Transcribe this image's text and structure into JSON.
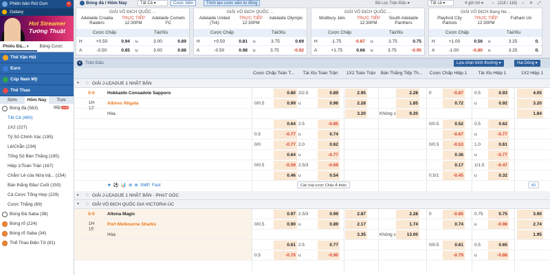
{
  "sidebar": {
    "top_links": [
      "Phiên bản Rút Gọn",
      "Galaxy"
    ],
    "banner": {
      "line1": "Hot Streamer",
      "line2": "Tướng Thuật"
    },
    "tabs": [
      "Phiếu Đặ...",
      "Bảng Cược"
    ],
    "categories": [
      {
        "label": "Thể Vận Hội",
        "color": "#f5a623"
      },
      {
        "label": "Euro",
        "color": "#3b7dd8"
      },
      {
        "label": "Cúp Nam Mỹ",
        "color": "#2ea44f"
      },
      {
        "label": "Thể Thao",
        "color": "#e54b4b"
      }
    ],
    "time_tabs": [
      "Sớm",
      "Hôm Nay",
      "Trực tiếp"
    ],
    "live_badge": "LIVE",
    "sports_top": {
      "label": "Bóng đá",
      "count": "(563)"
    },
    "items": [
      {
        "label": "Tất Cả",
        "count": "(480)"
      },
      {
        "label": "1X2",
        "count": "(227)"
      },
      {
        "label": "Tỷ Số Chính Xác",
        "count": "(195)"
      },
      {
        "label": "Lẻ/Chẵn",
        "count": "(234)"
      },
      {
        "label": "Tổng Số Bàn Thắng",
        "count": "(195)"
      },
      {
        "label": "Hiệp 1/Toàn Trận",
        "count": "(167)"
      },
      {
        "label": "Chẵn/ Lẻ của Nửa trậ...",
        "count": "(154)"
      },
      {
        "label": "Bàn thắng Đầu/ Cuối",
        "count": "(150)"
      },
      {
        "label": "Cá Cược Tổng Hợp",
        "count": "(229)"
      },
      {
        "label": "Cược Thắng",
        "count": "(69)"
      }
    ],
    "sports_bottom": [
      {
        "label": "Bóng Đá Saba",
        "count": "(38)"
      },
      {
        "label": "Bóng rổ",
        "count": "(224)"
      },
      {
        "label": "Bóng rổ Saba",
        "count": "(34)"
      },
      {
        "label": "Thể Thao Điện Tử",
        "count": "(81)"
      }
    ]
  },
  "topbar": {
    "title": "Bóng đá / Hôm Nay",
    "select_all": "Tất Cả",
    "btn_bet": "Cược Xiên",
    "btn_create": "Trình tạo cược xiên tự động",
    "filter": "Bộ Lọc Trận Đấu",
    "filter_all": "Tất cả",
    "hours": "4 giờ tới",
    "pager": "(118 / 118)",
    "cards": [
      {
        "league": "GIẢI VÔ ĐỊCH QUỐC ...",
        "home": "Adelaide Croatia Raiders",
        "away": "Adelaide Comets FC",
        "live": "TRỰC TIẾP",
        "time": "12:30PM",
        "hdr": [
          "Cược Chấp",
          "Tài/Xỉu"
        ],
        "rows": [
          {
            "a": "H",
            "b": "+0.50",
            "c": "0.94",
            "d": "u",
            "e": "3.00",
            "f": "0.89",
            "cneg": false,
            "fneg": false
          },
          {
            "a": "A",
            "b": "-0.50",
            "c": "0.85",
            "d": "u",
            "e": "3.00",
            "f": "0.88",
            "cneg": false,
            "fneg": false
          }
        ]
      },
      {
        "league": "GIẢI VÔ ĐỊCH QUỐC ...",
        "home": "Adelaide United (Trẻ)",
        "away": "Adelaide Olympic",
        "live": "TRỰC TIẾP",
        "time": "12:30PM",
        "hdr": [
          "Cược Chấp",
          "Tài/Xỉu"
        ],
        "rows": [
          {
            "a": "H",
            "b": "+0.50",
            "c": "0.81",
            "d": "u",
            "e": "3.75",
            "f": "0.69",
            "cneg": false,
            "fneg": false
          },
          {
            "a": "A",
            "b": "-0.50",
            "c": "0.98",
            "d": "u",
            "e": "3.75",
            "f": "-0.92",
            "cneg": false,
            "fneg": true
          }
        ]
      },
      {
        "league": "GIẢI VÔ ĐỊCH QUỐC ...",
        "home": "Modbury Jets",
        "away": "South Adelaide Panthers",
        "live": "TRỰC TIẾP",
        "time": "12:30PM",
        "hdr": [
          "Cược Chấp",
          "Tài/Xỉu"
        ],
        "rows": [
          {
            "a": "H",
            "b": "-1.75",
            "c": "-0.87",
            "d": "u",
            "e": "3.75",
            "f": "0.75",
            "cneg": true,
            "fneg": false
          },
          {
            "a": "A",
            "b": "+1.75",
            "c": "0.66",
            "d": "u",
            "e": "3.75",
            "f": "-0.95",
            "cneg": false,
            "fneg": true
          }
        ]
      },
      {
        "league": "GIẢI VÔ ĐỊCH Bang Ne...",
        "home": "Playford City Patriots",
        "away": "Fulham Un",
        "live": "TRỰC TIẾP",
        "time": "12:30PM",
        "hdr": [
          "Cược Chấp",
          "Tài/Xỉu"
        ],
        "rows": [
          {
            "a": "H",
            "b": "+1.00",
            "c": "0.56",
            "d": "u",
            "e": "3.25",
            "f": "0.",
            "cneg": false,
            "fneg": false
          },
          {
            "a": "A",
            "b": "-1.00",
            "c": "-0.80",
            "d": "u",
            "e": "3.25",
            "f": "0.",
            "cneg": true,
            "fneg": false
          }
        ]
      }
    ]
  },
  "main": {
    "header_label": "Trận Đấu",
    "sort_select": "Lựa chọn bình thường",
    "line_select": "Hai Dòng",
    "columns": [
      "Cược Chấp Toàn T...",
      "Tài Xỉu Toàn Trận",
      "1X2 Toàn Trận",
      "Bàn Thắng Tiếp Th...",
      "Cược Chấp Hiệp 1",
      "Tài Xỉu Hiệp 1",
      "1X2 Hiệp 1"
    ],
    "leagues": [
      {
        "name": "GIẢI J-LEAGUE 1 NHẬT BẢN",
        "score": "0-0",
        "half": "1H",
        "minute": "12'",
        "home": "Hokkaido Consadole Sapporo",
        "away": "Albirex Niigata",
        "draw": "Hòa",
        "icons": [
          "★",
          "⚽",
          "📊",
          "⊕",
          "⊗",
          "SMP",
          "Fast"
        ],
        "more": "Các loại cược Châu Á khác",
        "count": "83"
      },
      {
        "name": "GIẢI J-LEAGUE 1 NHẬT BẢN - PHẠT GÓC",
        "count": ""
      },
      {
        "name": "GIẢI VÔ ĐỊCH QUỐC GIA VICTORIA ÚC",
        "score": "0-0",
        "half": "1H",
        "minute": "15'",
        "home": "Altona Magic",
        "away": "Port Melbourne Sharks",
        "draw": "Hòa"
      }
    ],
    "rows_a": [
      {
        "hc1": "",
        "ho1": "0.80",
        "ou1": "2/2.5",
        "ouo1": "0.89",
        "x1": "2.95",
        "nx": "",
        "nxv": "2.28",
        "hch": "0",
        "hcho": "-0.87",
        "ouh": "0.5",
        "ouho": "0.93",
        "x1h": "4.05"
      },
      {
        "hc1": "0/0.5",
        "ho1": "0.99",
        "ou1": "u",
        "ouo1": "0.96",
        "x1": "2.28",
        "nx": "",
        "nxv": "1.85",
        "hch": "",
        "hcho": "0.72",
        "ouh": "u",
        "ouho": "0.92",
        "x1h": "3.20"
      },
      {
        "hc1": "",
        "ho1": "",
        "ou1": "",
        "ouo1": "",
        "x1": "3.20",
        "nx": "Không có",
        "nxv": "9.20",
        "hch": "",
        "hcho": "",
        "ouh": "",
        "ouho": "",
        "x1h": "1.84"
      },
      {
        "hc1": "",
        "ho1": "0.64",
        "ou1": "2.5",
        "ouo1": "-0.85",
        "x1": "",
        "nx": "",
        "nxv": "",
        "hch": "0/0.5",
        "hcho": "0.52",
        "ouh": "0.5",
        "ouho": "0.62",
        "x1h": ""
      },
      {
        "hc1": "0.5",
        "ho1": "-0.77",
        "ou1": "u",
        "ouo1": "0.74",
        "x1": "",
        "nx": "",
        "nxv": "",
        "hch": "",
        "hcho": "-0.67",
        "ouh": "u",
        "ouho": "-0.77",
        "x1h": ""
      },
      {
        "hc1": "0/0",
        "ho1": "-0.77",
        "ou1": "2.0",
        "ouo1": "0.62",
        "x1": "",
        "nx": "",
        "nxv": "",
        "hch": "0/0.5",
        "hcho": "-0.53",
        "ouh": "1.0",
        "ouho": "0.61",
        "x1h": ""
      },
      {
        "hc1": "",
        "ho1": "0.64",
        "ou1": "u",
        "ouo1": "-0.77",
        "x1": "",
        "nx": "",
        "nxv": "",
        "hch": "",
        "hcho": "0.36",
        "ouh": "u",
        "ouho": "-0.77",
        "x1h": ""
      },
      {
        "hc1": "0/0.5",
        "ho1": "-0.59",
        "ou1": "2.5/3",
        "ouo1": "-0.69",
        "x1": "",
        "nx": "",
        "nxv": "",
        "hch": "",
        "hcho": "0.17",
        "ouh": "1/1.5",
        "ouho": "-0.47",
        "x1h": ""
      },
      {
        "hc1": "",
        "ho1": "0.46",
        "ou1": "u",
        "ouo1": "0.54",
        "x1": "",
        "nx": "",
        "nxv": "",
        "hch": "0.5/1",
        "hcho": "-0.45",
        "ouh": "u",
        "ouho": "0.32",
        "x1h": ""
      }
    ],
    "rows_b": [
      {
        "hc1": "",
        "ho1": "0.97",
        "ou1": "2.5/3",
        "ouo1": "0.99",
        "x1": "2.87",
        "nx": "",
        "nxv": "2.28",
        "hch": "0",
        "hcho": "-0.85",
        "ouh": "0.75",
        "ouho": "0.75",
        "x1h": "3.90"
      },
      {
        "hc1": "0/0.5",
        "ho1": "0.90",
        "ou1": "u",
        "ouo1": "0.89",
        "x1": "2.17",
        "nx": "",
        "nxv": "1.74",
        "hch": "",
        "hcho": "0.74",
        "ouh": "u",
        "ouho": "-0.98",
        "x1h": "2.74"
      },
      {
        "hc1": "",
        "ho1": "",
        "ou1": "",
        "ouo1": "",
        "x1": "3.35",
        "nx": "Không có",
        "nxv": "13.00",
        "hch": "",
        "hcho": "",
        "ouh": "",
        "ouho": "",
        "x1h": "1.95"
      },
      {
        "hc1": "",
        "ho1": "0.61",
        "ou1": "2.5",
        "ouo1": "0.77",
        "x1": "",
        "nx": "",
        "nxv": "",
        "hch": "0/0.5",
        "hcho": "0.61",
        "ouh": "0.5",
        "ouho": "0.65",
        "x1h": ""
      },
      {
        "hc1": "0.5",
        "ho1": "-0.70",
        "ou1": "u",
        "ouo1": "-0.90",
        "x1": "",
        "nx": "",
        "nxv": "",
        "hch": "",
        "hcho": "-0.79",
        "ouh": "u",
        "ouho": "-0.88",
        "x1h": ""
      }
    ]
  },
  "colors": {
    "brand": "#1c4f8a",
    "accent_orange": "#e8761b",
    "negative": "#d43f2a"
  }
}
